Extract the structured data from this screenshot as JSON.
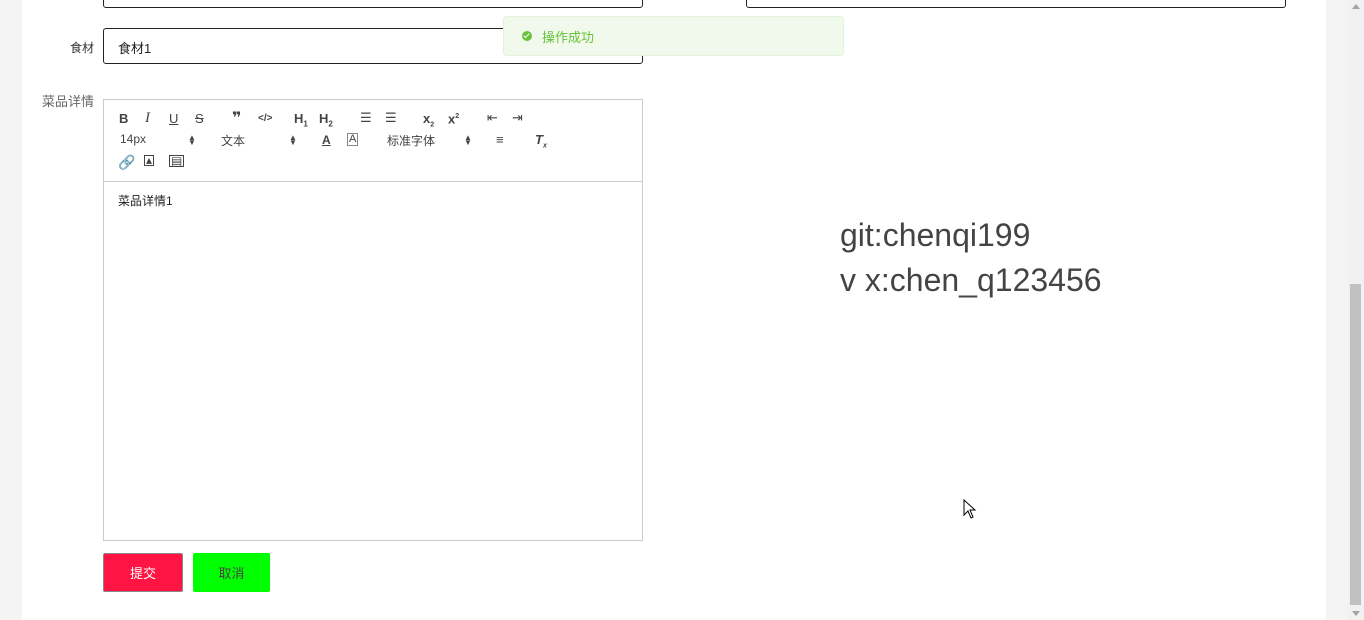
{
  "toast": {
    "message": "操作成功",
    "icon": "check-circle-icon",
    "color": "#67c23a"
  },
  "form": {
    "ingredients": {
      "label": "食材",
      "value": "食材1"
    },
    "detail": {
      "label": "菜品详情"
    }
  },
  "editor": {
    "font_size": "14px",
    "text_type": "文本",
    "font_family": "标准字体",
    "content": "菜品详情1"
  },
  "buttons": {
    "submit": "提交",
    "cancel": "取消",
    "submit_color": "#ff1443",
    "cancel_color": "#00ff00"
  },
  "watermark": {
    "line1": "git:chenqi199",
    "line2": "v x:chen_q123456"
  }
}
